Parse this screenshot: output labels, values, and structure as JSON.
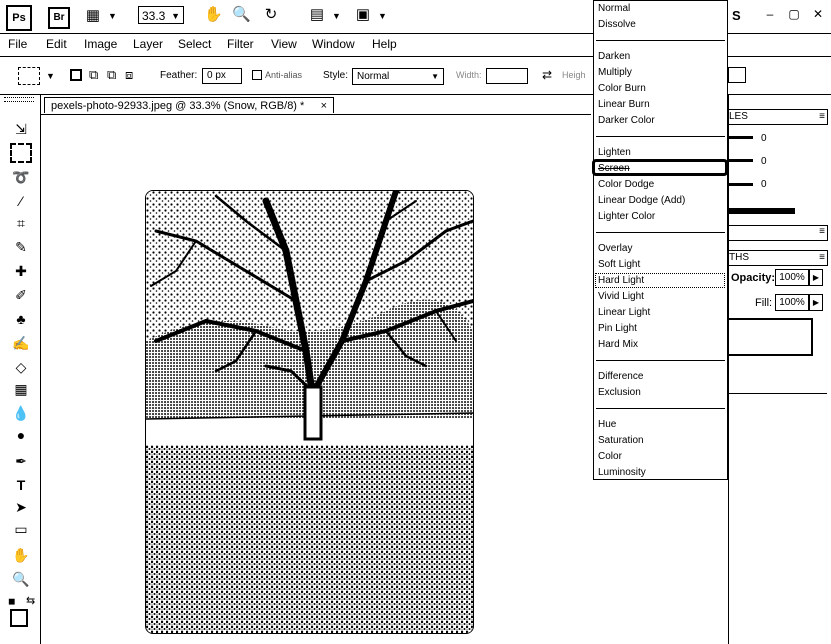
{
  "appbar": {
    "ps_logo": "Ps",
    "br_logo": "Br",
    "zoom": "33.3",
    "workspace_fragment": "S",
    "window_controls": [
      "–",
      "▢",
      "✕"
    ]
  },
  "menubar": {
    "items": [
      "File",
      "Edit",
      "Image",
      "Layer",
      "Select",
      "Filter",
      "View",
      "Window",
      "Help"
    ]
  },
  "options": {
    "feather_label": "Feather:",
    "feather_value": "0 px",
    "antialias_label": "Anti-alias",
    "style_label": "Style:",
    "style_value": "Normal",
    "width_label": "Width:",
    "height_label": "Heigh"
  },
  "document": {
    "tab_title": "pexels-photo-92933.jpeg @ 33.3% (Snow, RGB/8) *",
    "tab_close": "×"
  },
  "right_panel": {
    "tab1": "LES",
    "val1": "0",
    "val2": "0",
    "val3": "0",
    "tab2": "THS",
    "opacity_label": "Opacity:",
    "opacity_value": "100%",
    "fill_label": "Fill:",
    "fill_value": "100%"
  },
  "blend_modes": {
    "groups": [
      [
        "Normal",
        "Dissolve"
      ],
      [
        "Darken",
        "Multiply",
        "Color Burn",
        "Linear Burn",
        "Darker Color"
      ],
      [
        "Lighten",
        "Screen",
        "Color Dodge",
        "Linear Dodge (Add)",
        "Lighter Color"
      ],
      [
        "Overlay",
        "Soft Light",
        "Hard Light",
        "Vivid Light",
        "Linear Light",
        "Pin Light",
        "Hard Mix"
      ],
      [
        "Difference",
        "Exclusion"
      ],
      [
        "Hue",
        "Saturation",
        "Color",
        "Luminosity"
      ]
    ],
    "highlighted": "Screen",
    "selected": "Hard Light"
  },
  "colors": {
    "ink": "#000000",
    "paper": "#ffffff",
    "highlight_outline": "#000000"
  }
}
